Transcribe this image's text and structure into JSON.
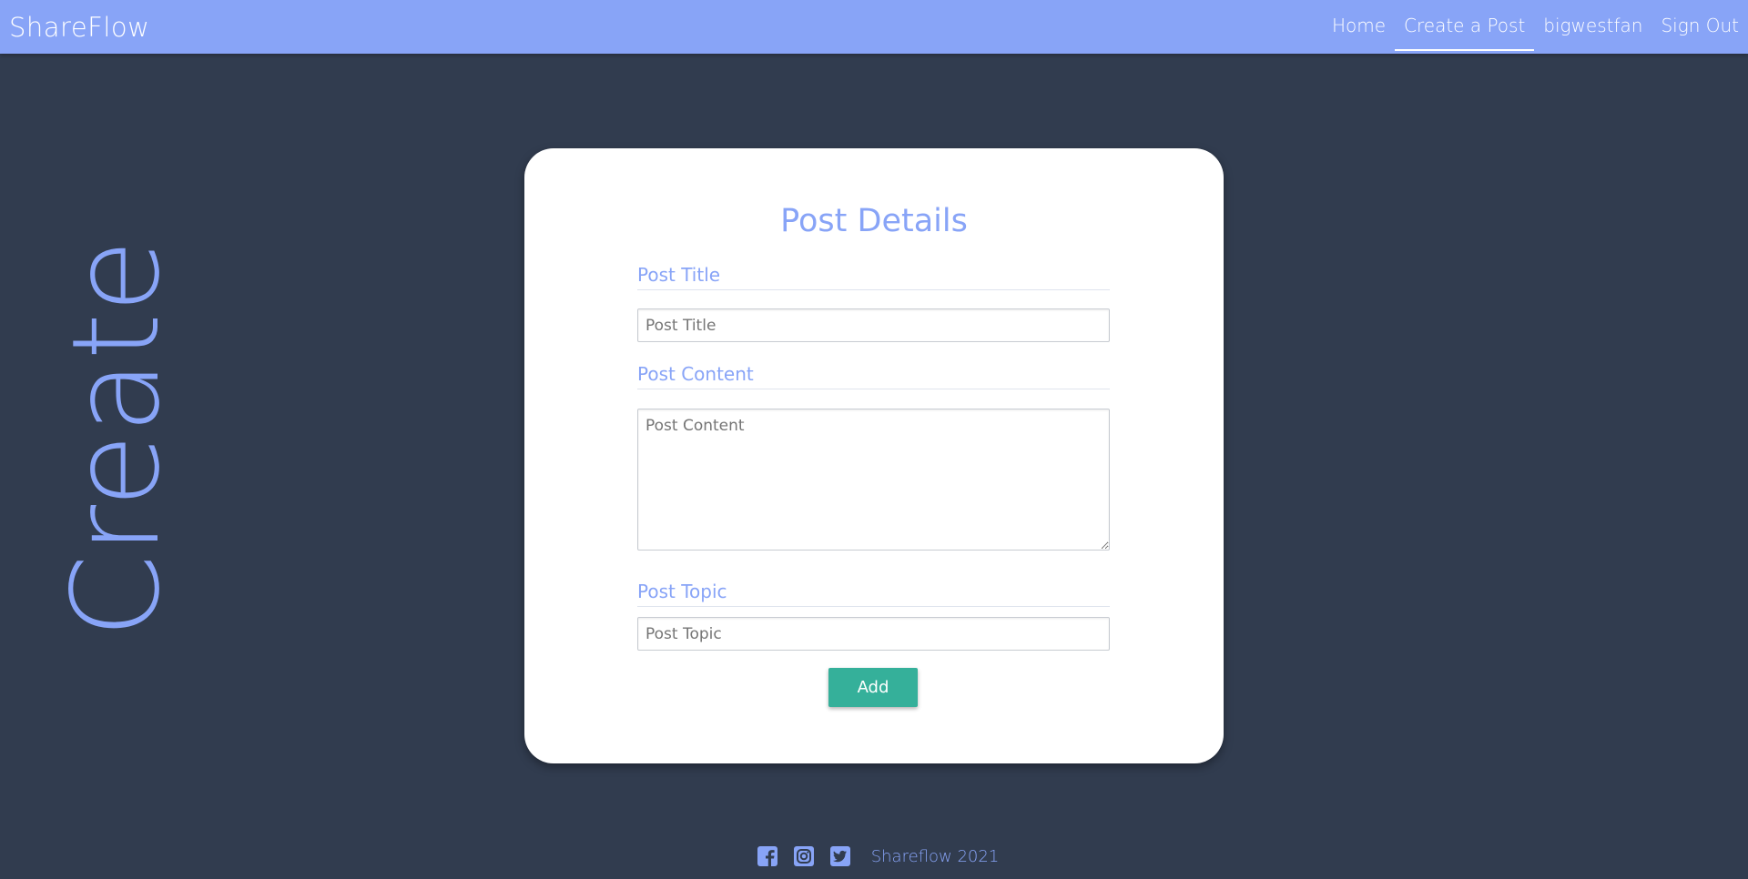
{
  "nav": {
    "brand": "ShareFlow",
    "links": [
      {
        "label": "Home",
        "active": false
      },
      {
        "label": "Create a Post",
        "active": true
      },
      {
        "label": "bigwestfan",
        "active": false
      },
      {
        "label": "Sign Out",
        "active": false
      }
    ]
  },
  "side_heading": "Create",
  "form": {
    "title": "Post Details",
    "title_field": {
      "label": "Post Title",
      "placeholder": "Post Title",
      "value": ""
    },
    "content_field": {
      "label": "Post Content",
      "placeholder": "Post Content",
      "value": ""
    },
    "topic_field": {
      "label": "Post Topic",
      "placeholder": "Post Topic",
      "value": ""
    },
    "submit_label": "Add"
  },
  "footer": {
    "icons": [
      "facebook-icon",
      "instagram-icon",
      "twitter-icon"
    ],
    "text": "Shareflow 2021"
  },
  "colors": {
    "accent": "#88a4f7",
    "background": "#313c4f",
    "button": "#35b09a",
    "card": "#ffffff"
  }
}
